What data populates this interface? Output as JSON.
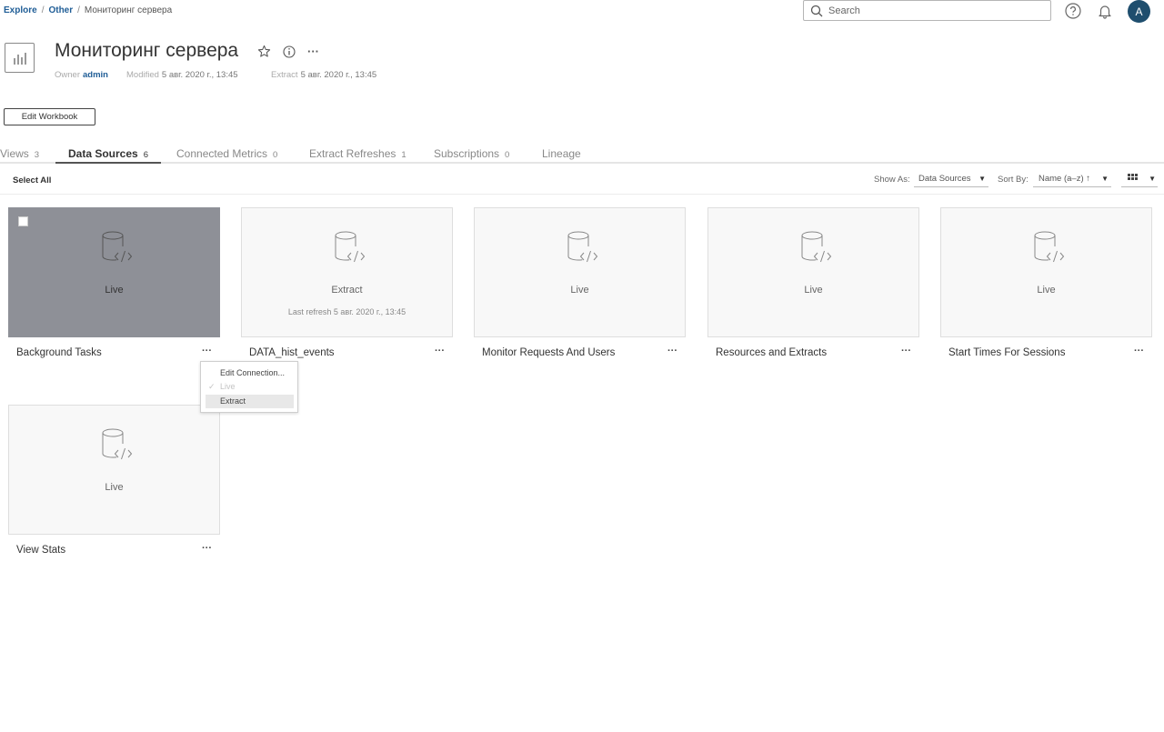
{
  "breadcrumb": {
    "items": [
      "Explore",
      "Other",
      "Мониторинг сервера"
    ],
    "separator": "/"
  },
  "search": {
    "placeholder": "Search"
  },
  "user": {
    "avatar_initial": "A",
    "avatar_color": "#1f4e6e"
  },
  "workbook": {
    "title": "Мониторинг сервера",
    "owner_label": "Owner",
    "owner": "admin",
    "modified_label": "Modified",
    "modified": "5 авг. 2020 г., 13:45",
    "extract_label": "Extract",
    "extract": "5 авг. 2020 г., 13:45",
    "more_glyph": "···"
  },
  "edit_button": {
    "label": "Edit Workbook"
  },
  "tabs": [
    {
      "label": "Views",
      "count": "3",
      "active": false
    },
    {
      "label": "Data Sources",
      "count": "6",
      "active": true
    },
    {
      "label": "Connected Metrics",
      "count": "0",
      "active": false
    },
    {
      "label": "Extract Refreshes",
      "count": "1",
      "active": false
    },
    {
      "label": "Subscriptions",
      "count": "0",
      "active": false
    },
    {
      "label": "Lineage",
      "count": "",
      "active": false
    }
  ],
  "toolbar": {
    "select_all": "Select All",
    "show_as_label": "Show As:",
    "show_as_value": "Data Sources",
    "sort_by_label": "Sort By:",
    "sort_by_value": "Name (a–z) ↑"
  },
  "cards": [
    {
      "name": "Background Tasks",
      "type": "Live",
      "last_refresh": "",
      "more": "···"
    },
    {
      "name": "DATA_hist_events",
      "type": "Extract",
      "last_refresh": "Last refresh 5 авг. 2020 г., 13:45",
      "more": "···"
    },
    {
      "name": "Monitor Requests And Users",
      "type": "Live",
      "last_refresh": "",
      "more": "···"
    },
    {
      "name": "Resources and Extracts",
      "type": "Live",
      "last_refresh": "",
      "more": "···"
    },
    {
      "name": "Start Times For Sessions",
      "type": "Live",
      "last_refresh": "",
      "more": "···"
    },
    {
      "name": "View Stats",
      "type": "Live",
      "last_refresh": "",
      "more": "···"
    }
  ],
  "context_menu": {
    "items": [
      {
        "label": "Edit Connection...",
        "state": "enabled"
      },
      {
        "label": "Live",
        "state": "disabled-checked",
        "check": "✓"
      },
      {
        "label": "Extract",
        "state": "highlighted"
      }
    ]
  },
  "colors": {
    "link": "#1f5d96",
    "hover_card": "#8e9097",
    "card_bg": "#f8f8f8"
  }
}
